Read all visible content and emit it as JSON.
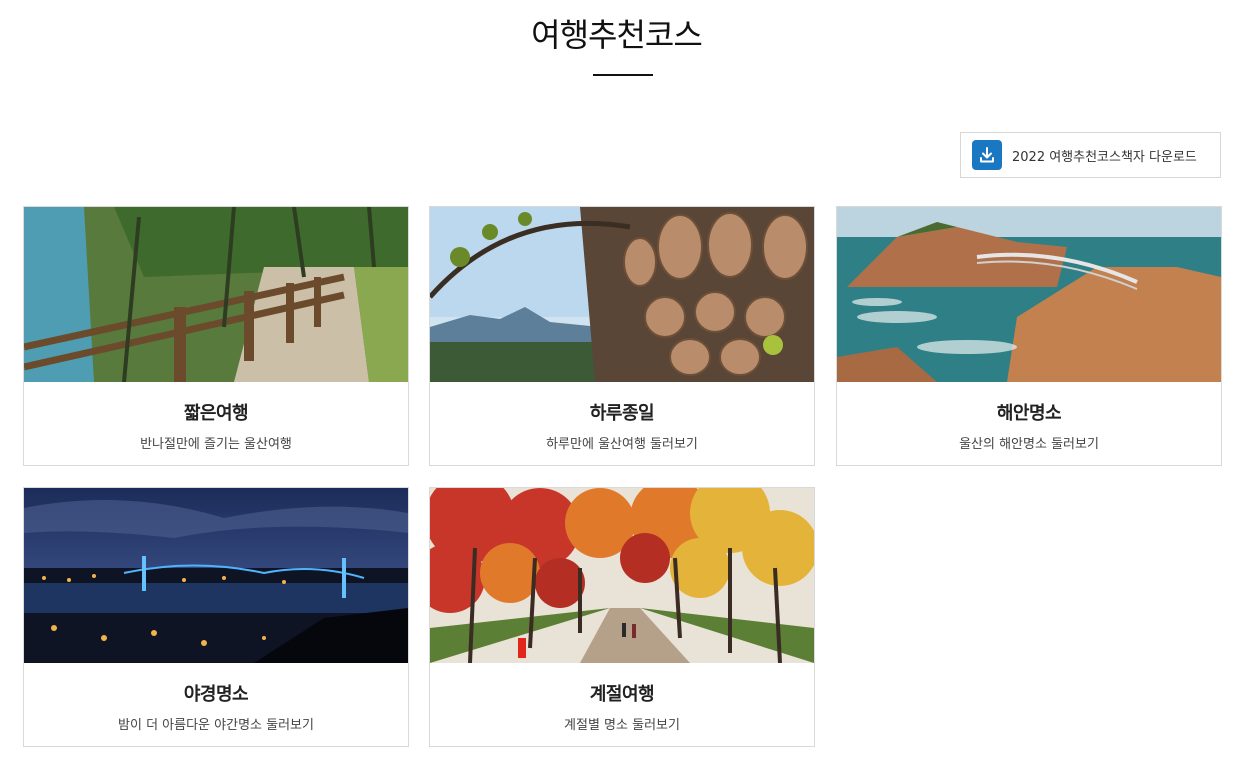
{
  "page": {
    "title": "여행추천코스"
  },
  "download": {
    "label": "2022 여행추천코스책자 다운로드",
    "icon": "download-icon",
    "color": "#1a78c2"
  },
  "cards": [
    {
      "title": "짧은여행",
      "desc": "반나절만에 즐기는 울산여행",
      "image": "coastal-boardwalk-image"
    },
    {
      "title": "하루종일",
      "desc": "하루만에 울산여행 둘러보기",
      "image": "onggi-pottery-image"
    },
    {
      "title": "해안명소",
      "desc": "울산의 해안명소 둘러보기",
      "image": "coastal-rocks-bridge-image"
    },
    {
      "title": "야경명소",
      "desc": "밤이 더 아름다운 야간명소 둘러보기",
      "image": "night-bridge-image"
    },
    {
      "title": "계절여행",
      "desc": "계절별 명소 둘러보기",
      "image": "autumn-trees-image"
    }
  ]
}
